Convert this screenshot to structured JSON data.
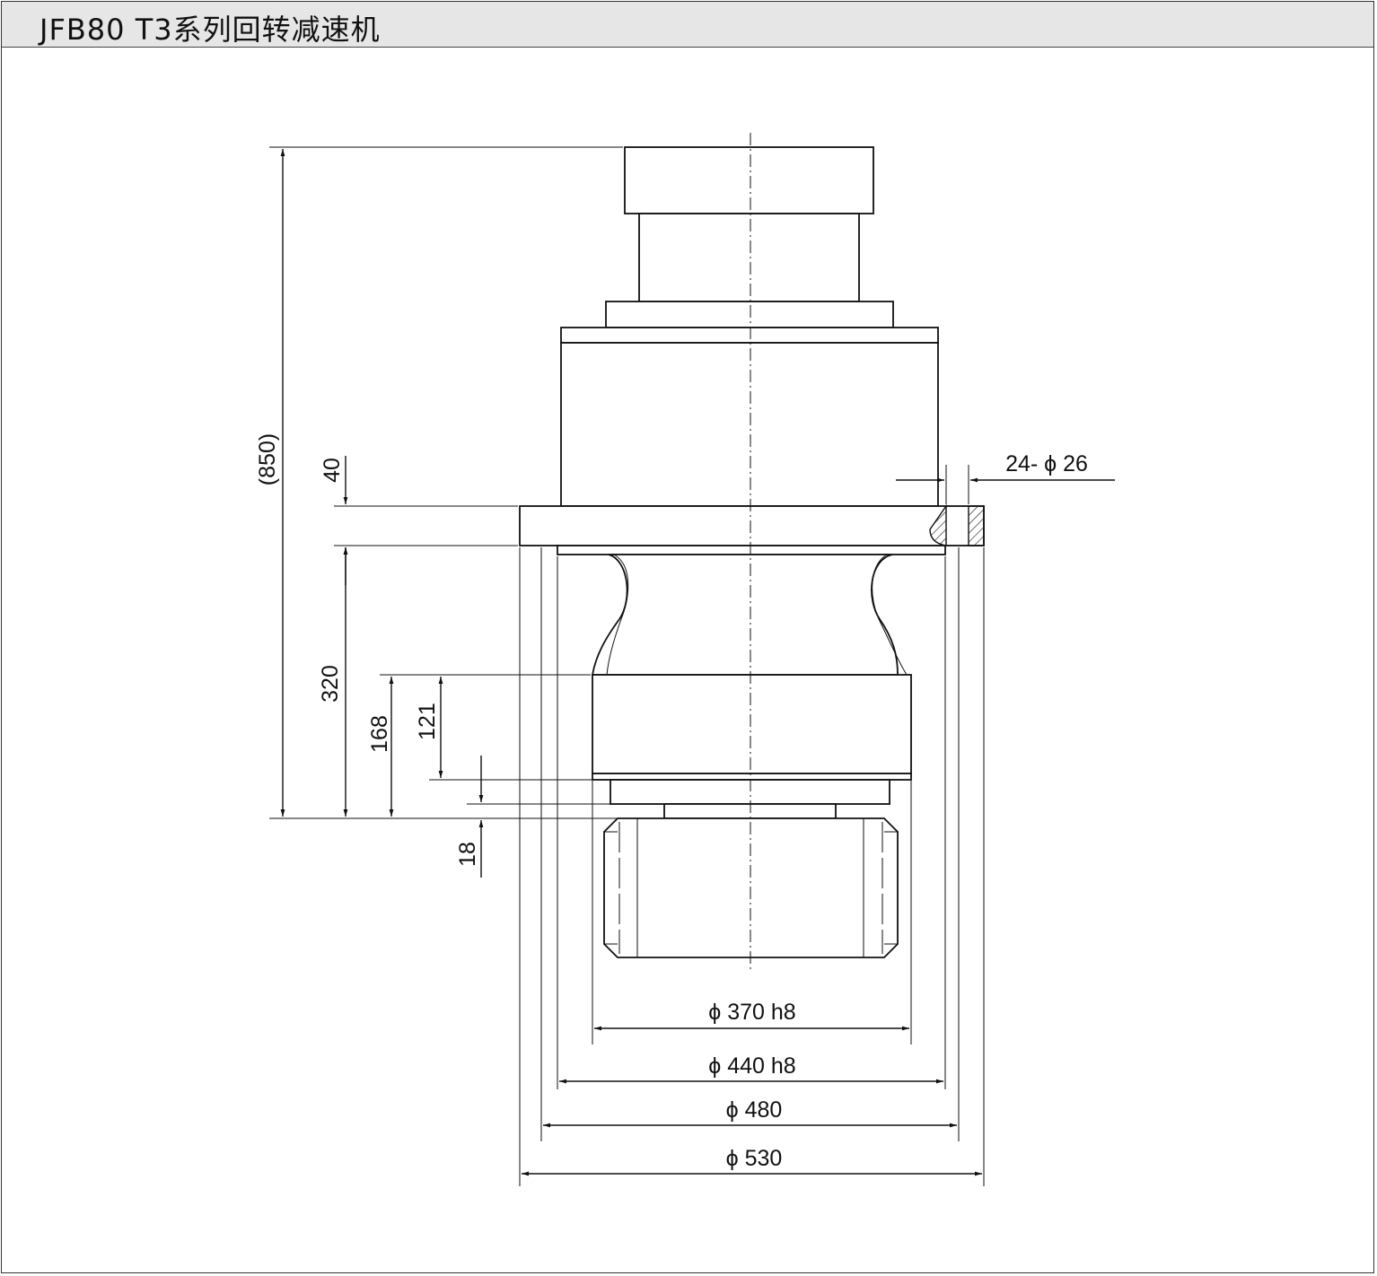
{
  "title": "JFB80 T3系列回转减速机",
  "dimensions": {
    "overall_height": "(850)",
    "flange_thickness": "40",
    "flange_to_bottom": "320",
    "pilot_168": "168",
    "pilot_121": "121",
    "spigot_18": "18",
    "bolt_holes": "24- ϕ 26",
    "d370": "ϕ 370  h8",
    "d440": "ϕ 440  h8",
    "d480": "ϕ 480",
    "d530": "ϕ 530"
  }
}
